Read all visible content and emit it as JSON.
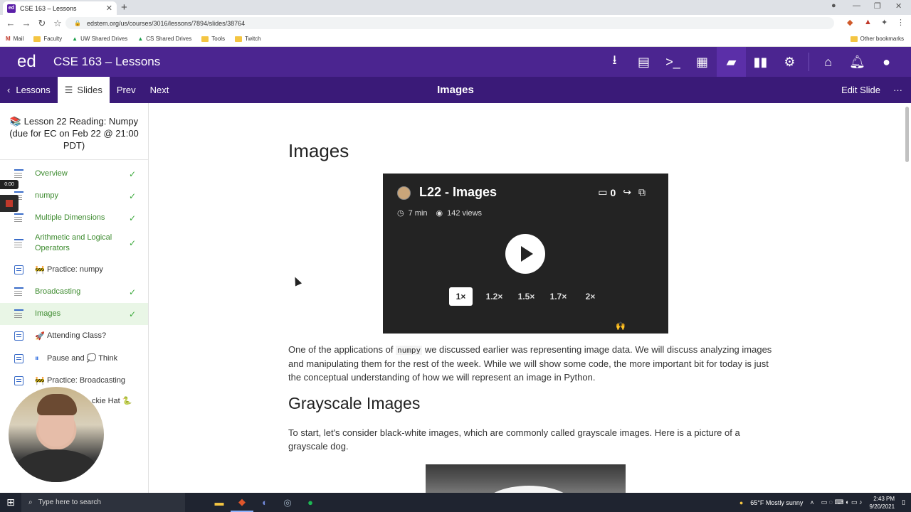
{
  "browser": {
    "tab_title": "CSE 163 – Lessons",
    "tab_favicon": "ed",
    "url": "edstem.org/us/courses/3016/lessons/7894/slides/38764",
    "bookmarks": [
      "Mail",
      "Faculty",
      "UW Shared Drives",
      "CS Shared Drives",
      "Tools",
      "Twitch"
    ],
    "other_bookmarks": "Other bookmarks"
  },
  "header": {
    "logo": "ed",
    "title": "CSE 163 – Lessons",
    "icons": [
      "download-icon",
      "chat-icon",
      "terminal-icon",
      "clipboard-icon",
      "lessons-icon",
      "analytics-icon",
      "settings-icon",
      "home-icon",
      "bell-icon",
      "user-icon"
    ]
  },
  "subnav": {
    "back": "Lessons",
    "slides": "Slides",
    "prev": "Prev",
    "next": "Next",
    "title": "Images",
    "edit": "Edit Slide",
    "more": "···"
  },
  "sidebar": {
    "lesson_title": "📚 Lesson 22 Reading: Numpy (due for EC on Feb 22 @ 21:00 PDT)",
    "items": [
      {
        "label": "Overview",
        "kind": "doc",
        "done": true
      },
      {
        "label": "numpy",
        "kind": "doc",
        "done": true
      },
      {
        "label": "Multiple Dimensions",
        "kind": "doc",
        "done": true
      },
      {
        "label": "Arithmetic and Logical Operators",
        "kind": "doc",
        "done": true
      },
      {
        "label": "Practice: numpy",
        "emoji": "🚧",
        "kind": "quiz",
        "done": false
      },
      {
        "label": "Broadcasting",
        "kind": "doc",
        "done": true
      },
      {
        "label": "Images",
        "kind": "doc",
        "done": true,
        "current": true
      },
      {
        "label": "Attending Class?",
        "emoji": "🚀",
        "kind": "quiz",
        "done": false
      },
      {
        "label": "Pause and 💭 Think",
        "emoji": "⏸",
        "kind": "quiz",
        "done": false
      },
      {
        "label": "Practice: Broadcasting",
        "emoji": "🚧",
        "kind": "quiz",
        "done": false
      },
      {
        "label": "…ckie Hat 🐍",
        "kind": "quiz",
        "done": false
      }
    ],
    "check": "✓"
  },
  "recording": {
    "time": "0:00"
  },
  "main": {
    "heading": "Images",
    "video": {
      "title": "L22 - Images",
      "duration": "7 min",
      "views": "142 views",
      "comments": "0",
      "speeds": [
        "1×",
        "1.2×",
        "1.5×",
        "1.7×",
        "2×"
      ],
      "selected_speed": "1×",
      "emoji": "🙌"
    },
    "para1_a": "One of the applications of",
    "para1_code": "numpy",
    "para1_b": "we discussed earlier was representing image data. We will discuss analyzing images and manipulating them for the rest of the week. While we will show some code, the more important bit for today is just the conceptual understanding of how we will represent an image in Python.",
    "subheading": "Grayscale Images",
    "para2": "To start, let's consider black-white images, which are commonly called grayscale images. Here is a picture of a grayscale dog."
  },
  "taskbar": {
    "search": "Type here to search",
    "weather": "65°F  Mostly sunny",
    "time": "2:43 PM",
    "date": "9/20/2021"
  },
  "colors": {
    "header": "#4b2590",
    "subnav": "#3a1a78",
    "done": "#3d8b2f",
    "current_bg": "#e9f6e6"
  }
}
